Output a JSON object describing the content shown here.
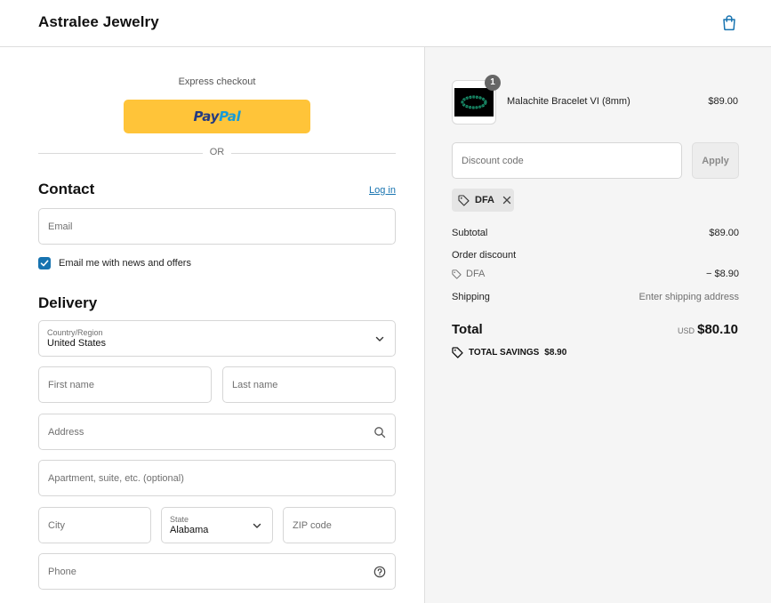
{
  "header": {
    "brand": "Astralee Jewelry",
    "cart_icon": "shopping-bag-icon"
  },
  "express": {
    "label": "Express checkout",
    "paypal_part1": "Pay",
    "paypal_part2": "Pal",
    "or": "OR"
  },
  "contact": {
    "title": "Contact",
    "login": "Log in",
    "email_placeholder": "Email",
    "newsletter_label": "Email me with news and offers",
    "newsletter_checked": true
  },
  "delivery": {
    "title": "Delivery",
    "country_label": "Country/Region",
    "country_value": "United States",
    "first_name_placeholder": "First name",
    "last_name_placeholder": "Last name",
    "address_placeholder": "Address",
    "apartment_placeholder": "Apartment, suite, etc. (optional)",
    "city_placeholder": "City",
    "state_label": "State",
    "state_value": "Alabama",
    "zip_placeholder": "ZIP code",
    "phone_placeholder": "Phone"
  },
  "order": {
    "item": {
      "quantity": "1",
      "name": "Malachite Bracelet VI (8mm)",
      "price": "$89.00"
    },
    "discount_placeholder": "Discount code",
    "apply_label": "Apply",
    "applied_code": "DFA",
    "subtotal_label": "Subtotal",
    "subtotal_value": "$89.00",
    "order_discount_label": "Order discount",
    "discount_code_label": "DFA",
    "discount_value": "− $8.90",
    "shipping_label": "Shipping",
    "shipping_value": "Enter shipping address",
    "total_label": "Total",
    "total_currency": "USD",
    "total_value": "$80.10",
    "savings_label": "TOTAL SAVINGS",
    "savings_value": "$8.90"
  },
  "colors": {
    "accent": "#1773b0",
    "paypal_yellow": "#ffc439",
    "summary_bg": "#f5f5f5"
  }
}
